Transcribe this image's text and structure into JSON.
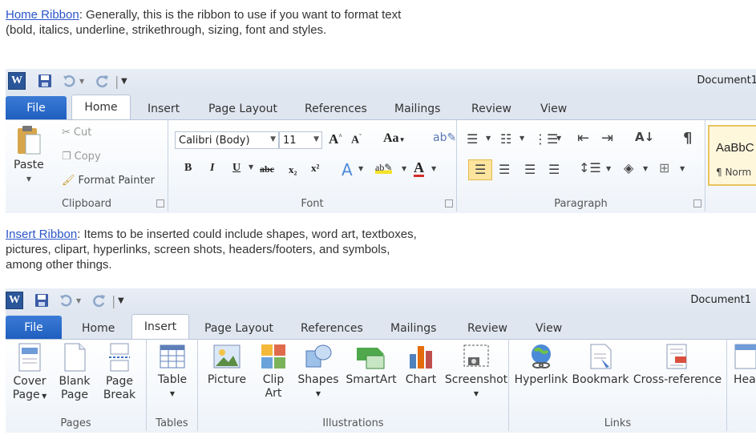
{
  "paragraph1": {
    "link": "Home Ribbon",
    "text": ": Generally, this is the ribbon to use if you want to format text",
    "line2": "(bold, italics, underline, strikethrough, sizing, font and styles."
  },
  "paragraph2": {
    "link": "Insert Ribbon",
    "text": ": Items to be inserted could include shapes, word art, textboxes,",
    "line2": "pictures, clipart, hyperlinks, screen shots, headers/footers, and symbols,",
    "line3": "among other things."
  },
  "window": {
    "logo": "W",
    "doc_title_1": "Document1",
    "doc_title_2": "Document1"
  },
  "tabs": [
    "File",
    "Home",
    "Insert",
    "Page Layout",
    "References",
    "Mailings",
    "Review",
    "View"
  ],
  "home": {
    "clipboard": {
      "paste": "Paste",
      "cut": "Cut",
      "copy": "Copy",
      "format_painter": "Format Painter",
      "label": "Clipboard"
    },
    "font": {
      "name": "Calibri (Body)",
      "size": "11",
      "change_case": "Aa",
      "label": "Font"
    },
    "paragraph": {
      "label": "Paragraph"
    },
    "styles": {
      "sample": "AaBbC",
      "normal": "¶ Norm"
    }
  },
  "insert": {
    "pages": {
      "cover_page_1": "Cover",
      "cover_page_2": "Page",
      "blank_page_1": "Blank",
      "blank_page_2": "Page",
      "page_break_1": "Page",
      "page_break_2": "Break",
      "label": "Pages"
    },
    "tables": {
      "table": "Table",
      "label": "Tables"
    },
    "illustrations": {
      "picture": "Picture",
      "clip_art_1": "Clip",
      "clip_art_2": "Art",
      "shapes": "Shapes",
      "smartart": "SmartArt",
      "chart": "Chart",
      "screenshot": "Screenshot",
      "label": "Illustrations"
    },
    "links": {
      "hyperlink": "Hyperlink",
      "bookmark": "Bookmark",
      "cross_reference": "Cross-reference",
      "label": "Links"
    },
    "header": "Hea"
  },
  "colors": {
    "file_tab": "#2b6cd0",
    "word_logo": "#2b579a",
    "link": "#2a55c9"
  }
}
